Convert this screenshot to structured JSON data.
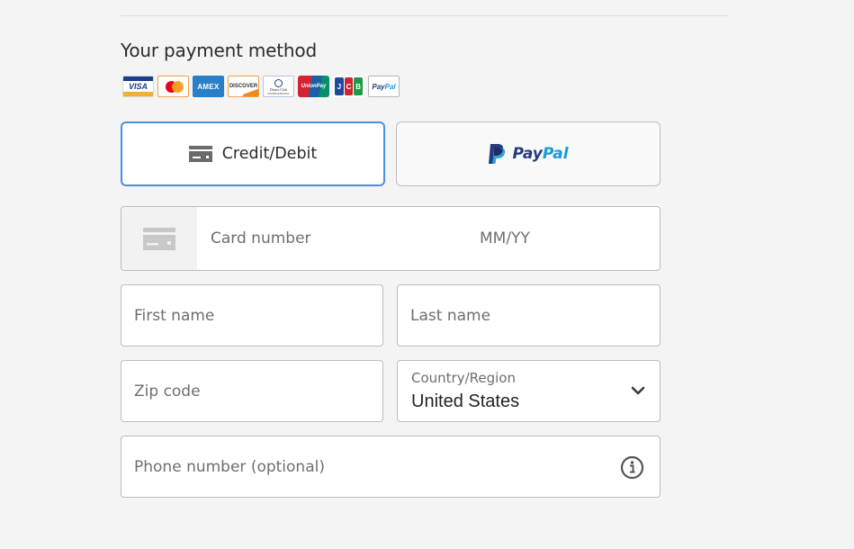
{
  "section": {
    "title": "Your payment method"
  },
  "logos": {
    "visa": "VISA",
    "mastercard": "mastercard",
    "amex": "AMEX",
    "discover": "DISCOVER",
    "diners_line1": "Diners Club",
    "diners_line2": "INTERNATIONAL",
    "unionpay": "UnionPay",
    "jcb_j": "J",
    "jcb_c": "C",
    "jcb_b": "B",
    "paypal_pay": "Pay",
    "paypal_pal": "Pal"
  },
  "methods": {
    "credit_label": "Credit/Debit",
    "paypal_pay": "Pay",
    "paypal_pal": "Pal",
    "selected": "credit"
  },
  "form": {
    "card_number_placeholder": "Card number",
    "expiry_placeholder": "MM/YY",
    "first_name_placeholder": "First name",
    "last_name_placeholder": "Last name",
    "zip_placeholder": "Zip code",
    "country_label": "Country/Region",
    "country_value": "United States",
    "phone_placeholder": "Phone number (optional)"
  },
  "colors": {
    "selected_border": "#4a90e2",
    "paypal_dark": "#253b80",
    "paypal_light": "#179bd7"
  }
}
